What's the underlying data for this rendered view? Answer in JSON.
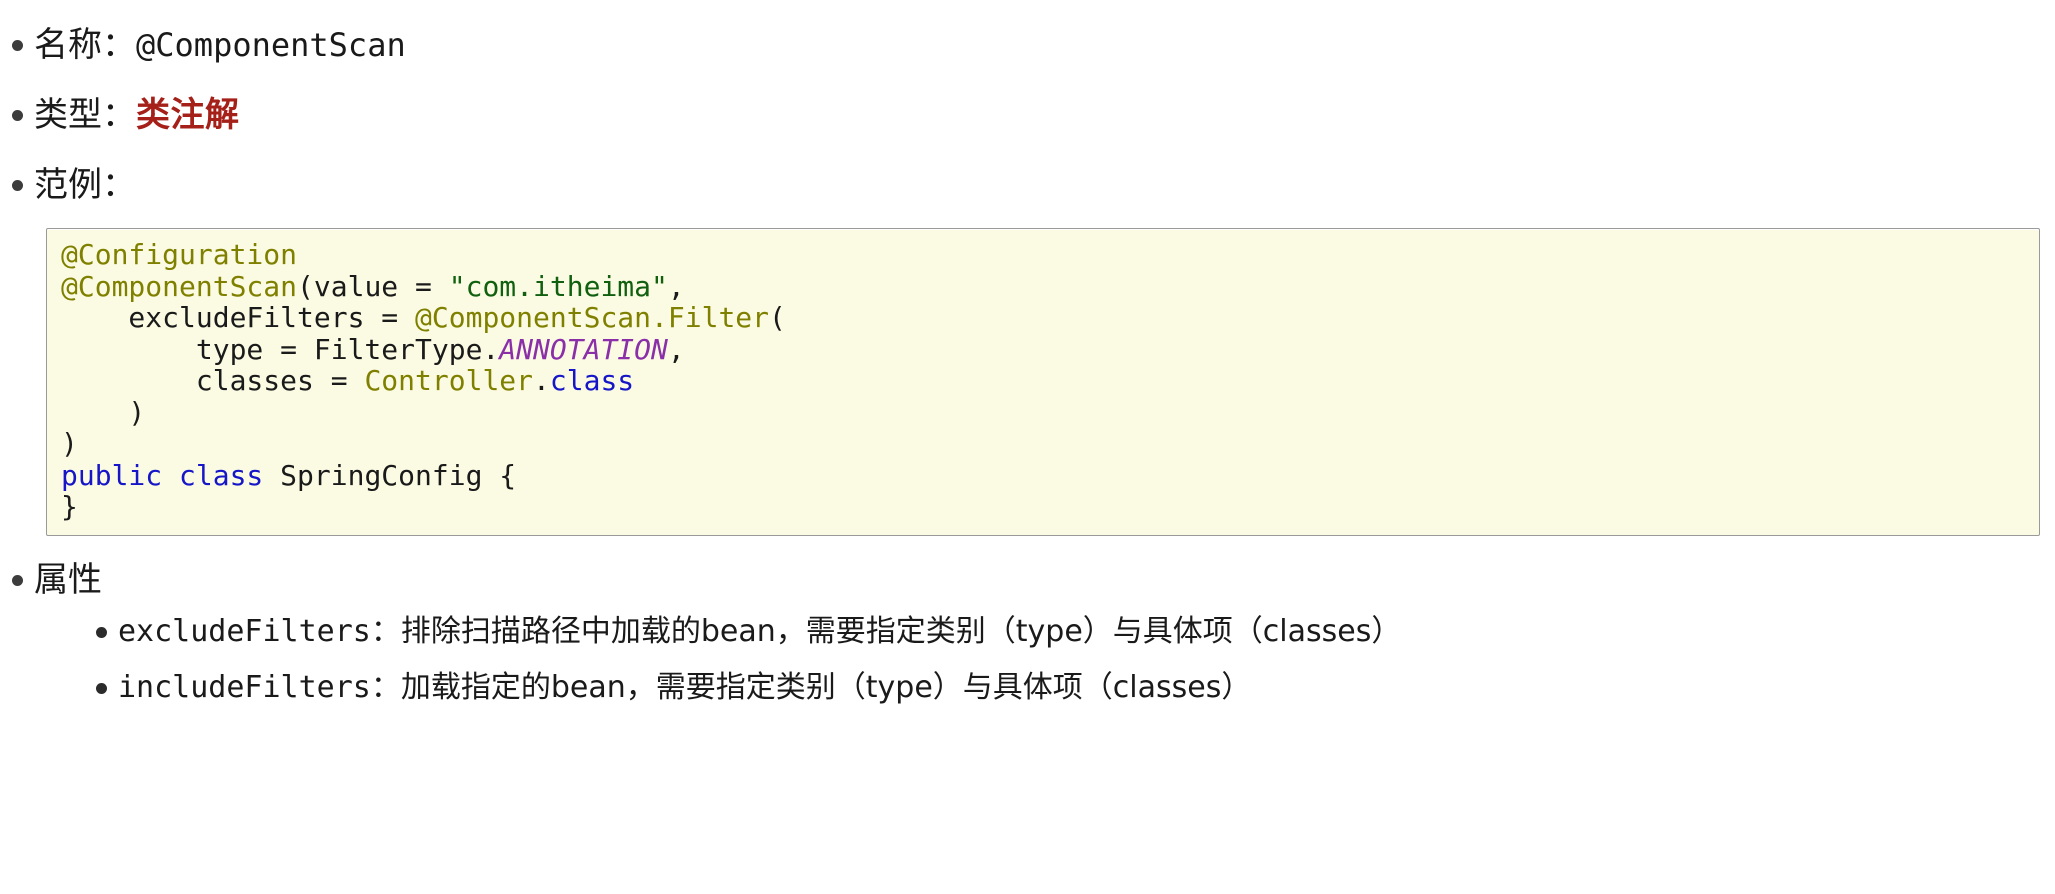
{
  "document": {
    "entries": [
      {
        "id": "name",
        "label": "名称：",
        "value": "@ComponentScan",
        "value_style": "mono"
      },
      {
        "id": "type",
        "label": "类型：",
        "value": "类注解",
        "value_style": "highlight",
        "value_color": "#a52019"
      },
      {
        "id": "sample",
        "label": "范例：",
        "value": "",
        "value_style": "none"
      }
    ],
    "code_sample": {
      "language": "java",
      "background_color": "#fbfbe3",
      "border_color": "#9a9a9a",
      "lines": [
        [
          {
            "t": "@Configuration",
            "c": "ann"
          }
        ],
        [
          {
            "t": "@ComponentScan",
            "c": "ann"
          },
          {
            "t": "(value = ",
            "c": "plain"
          },
          {
            "t": "\"com.itheima\"",
            "c": "str"
          },
          {
            "t": ",",
            "c": "plain"
          }
        ],
        [
          {
            "t": "    excludeFilters = ",
            "c": "plain"
          },
          {
            "t": "@ComponentScan.Filter",
            "c": "ann"
          },
          {
            "t": "(",
            "c": "plain"
          }
        ],
        [
          {
            "t": "        type = FilterType.",
            "c": "plain"
          },
          {
            "t": "ANNOTATION",
            "c": "static"
          },
          {
            "t": ",",
            "c": "plain"
          }
        ],
        [
          {
            "t": "        classes = ",
            "c": "plain"
          },
          {
            "t": "Controller",
            "c": "ann"
          },
          {
            "t": ".",
            "c": "plain"
          },
          {
            "t": "class",
            "c": "kw"
          }
        ],
        [
          {
            "t": "    )",
            "c": "plain"
          }
        ],
        [
          {
            "t": ")",
            "c": "plain"
          }
        ],
        [
          {
            "t": "public class",
            "c": "kw"
          },
          {
            "t": " SpringConfig {",
            "c": "plain"
          }
        ],
        [
          {
            "t": "}",
            "c": "plain"
          }
        ]
      ]
    },
    "attributes": {
      "heading": "属性",
      "items": [
        {
          "name": "excludeFilters",
          "separator": "：",
          "description": "排除扫描路径中加载的bean，需要指定类别（type）与具体项（classes）"
        },
        {
          "name": "includeFilters",
          "separator": "：",
          "description": "加载指定的bean，需要指定类别（type）与具体项（classes）"
        }
      ]
    }
  }
}
